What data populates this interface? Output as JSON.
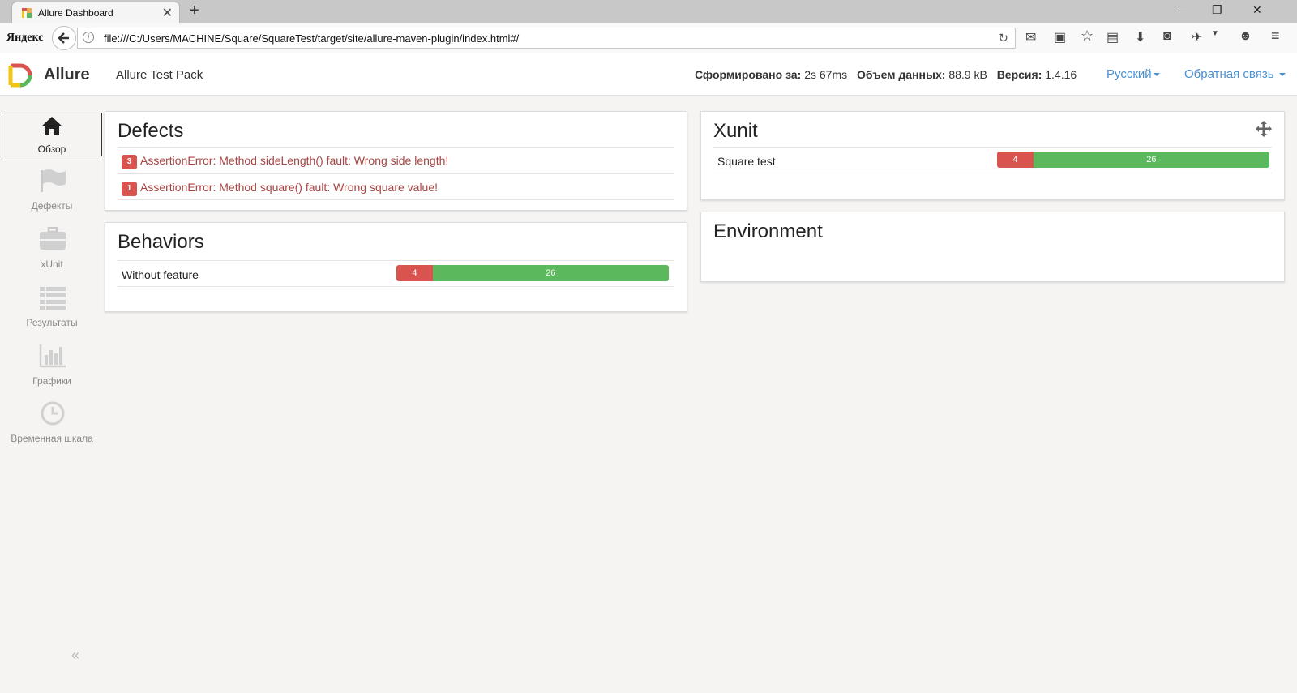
{
  "browser": {
    "tab_title": "Allure Dashboard",
    "new_tab": "+",
    "close": "✕",
    "yandex": "Яндекс",
    "url": "file:///C:/Users/MACHINE/Square/SquareTest/target/site/allure-maven-plugin/index.html#/"
  },
  "header": {
    "brand": "Allure",
    "report_name": "Allure Test Pack",
    "generated_label": "Сформировано за:",
    "generated_value": "2s 67ms",
    "size_label": "Объем данных:",
    "size_value": "88.9 kB",
    "version_label": "Версия:",
    "version_value": "1.4.16",
    "language": "Русский",
    "feedback": "Обратная связь"
  },
  "sidebar": {
    "items": [
      {
        "label": "Обзор",
        "icon": "home-icon",
        "active": true
      },
      {
        "label": "Дефекты",
        "icon": "flag-icon"
      },
      {
        "label": "xUnit",
        "icon": "briefcase-icon"
      },
      {
        "label": "Результаты",
        "icon": "list-icon"
      },
      {
        "label": "Графики",
        "icon": "bar-chart-icon"
      },
      {
        "label": "Временная шкала",
        "icon": "clock-icon"
      }
    ],
    "collapse": "«"
  },
  "defects": {
    "title": "Defects",
    "items": [
      {
        "count": "3",
        "message": "AssertionError: Method sideLength() fault: Wrong side length!"
      },
      {
        "count": "1",
        "message": "AssertionError: Method square() fault: Wrong square value!"
      }
    ]
  },
  "behaviors": {
    "title": "Behaviors",
    "rows": [
      {
        "name": "Without feature",
        "failed": 4,
        "passed": 26
      }
    ]
  },
  "xunit": {
    "title": "Xunit",
    "rows": [
      {
        "name": "Square test",
        "failed": 4,
        "passed": 26
      }
    ]
  },
  "environment": {
    "title": "Environment"
  },
  "colors": {
    "failed": "#d9534f",
    "passed": "#5cb85c",
    "link": "#4a8fd1",
    "defect_text": "#a94442"
  }
}
